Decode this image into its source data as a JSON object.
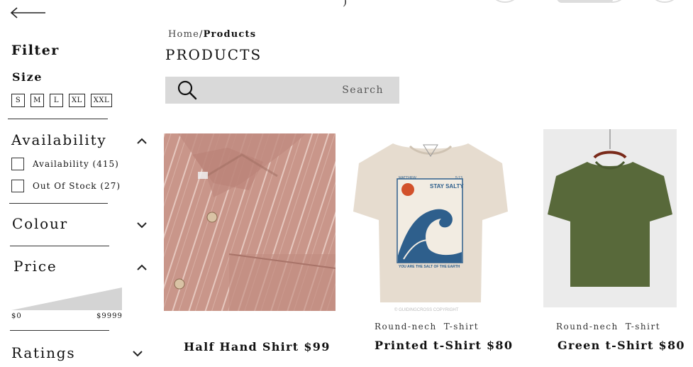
{
  "filter": {
    "title": "Filter",
    "size_title": "Size",
    "sizes": [
      "S",
      "M",
      "L",
      "XL",
      "XXL"
    ],
    "availability": {
      "title": "Availability",
      "options": [
        {
          "label": "Availability (415)",
          "checked": false
        },
        {
          "label": "Out Of Stock (27)",
          "checked": false
        }
      ]
    },
    "colour_title": "Colour",
    "price": {
      "title": "Price",
      "min_label": "$0",
      "max_label": "$9999"
    },
    "ratings_title": "Ratings"
  },
  "breadcrumb": {
    "home": "Home",
    "separator": "/",
    "current": "Products"
  },
  "page_title": "PRODUCTS",
  "search": {
    "placeholder": "Search"
  },
  "products": [
    {
      "name": "Half Hand Shirt $99",
      "tags": []
    },
    {
      "name": "Printed t-Shirt $80",
      "tags": [
        "Round-nech",
        "T-shirt"
      ],
      "print_text": {
        "top_left": "MATTHEW",
        "top_right": "5:13",
        "headline": "STAY SALTY",
        "footer": "YOU ARE THE SALT OF THE EARTH",
        "copyright": "© GUIDINGCROSS COPYRIGHT"
      }
    },
    {
      "name": "Green t-Shirt $80",
      "tags": [
        "Round-nech",
        "T-shirt"
      ]
    }
  ],
  "colors": {
    "search_bg": "#d9d9d9",
    "shirt_pink": "#c9968a",
    "tee_beige": "#e6dccf",
    "tee_wave": "#2e5f8c",
    "tee_green": "#58693a"
  }
}
